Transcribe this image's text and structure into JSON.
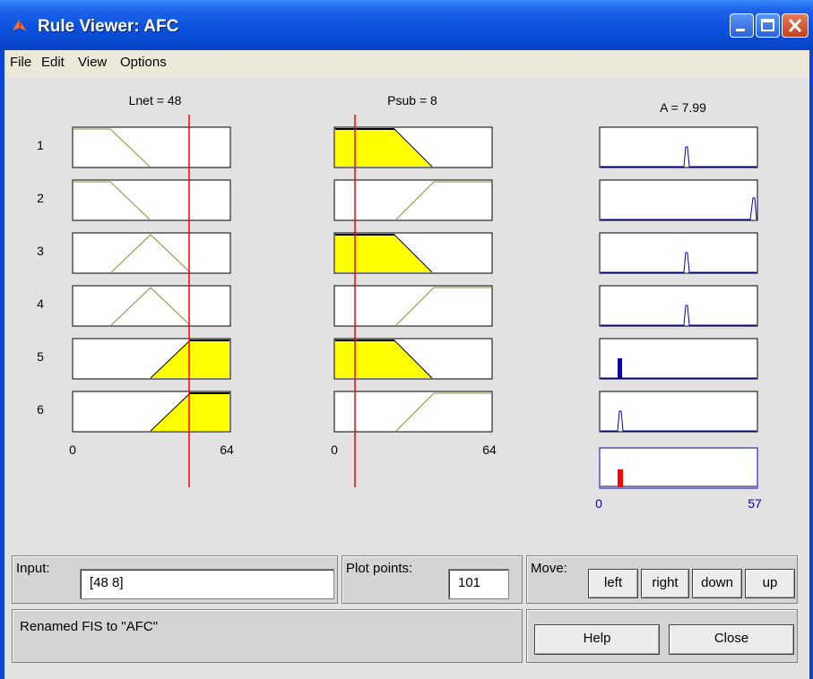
{
  "window": {
    "title": "Rule Viewer: AFC"
  },
  "menu": [
    "File",
    "Edit",
    "View",
    "Options"
  ],
  "plots": {
    "input_titles": [
      "Lnet = 48",
      "Psub = 8"
    ],
    "output_title": "A = 7.99",
    "rule_numbers": [
      "1",
      "2",
      "3",
      "4",
      "5",
      "6"
    ],
    "input_axis": [
      {
        "min_label": "0",
        "max_label": "64"
      },
      {
        "min_label": "0",
        "max_label": "64"
      }
    ],
    "output_axis": {
      "min_label": "0",
      "max_label": "57"
    }
  },
  "input_panel": {
    "label": "Input:",
    "value": "[48 8]"
  },
  "plot_points": {
    "label": "Plot points:",
    "value": "101"
  },
  "move": {
    "label": "Move:",
    "buttons": [
      "left",
      "right",
      "down",
      "up"
    ]
  },
  "status": {
    "text": "Renamed FIS to \"AFC\""
  },
  "actions": {
    "help": "Help",
    "close": "Close"
  },
  "colors": {
    "fill": "#ffff00",
    "index_line": "#ff0000",
    "output_line": "#0000c8",
    "aggregate": "#ff0000"
  }
}
